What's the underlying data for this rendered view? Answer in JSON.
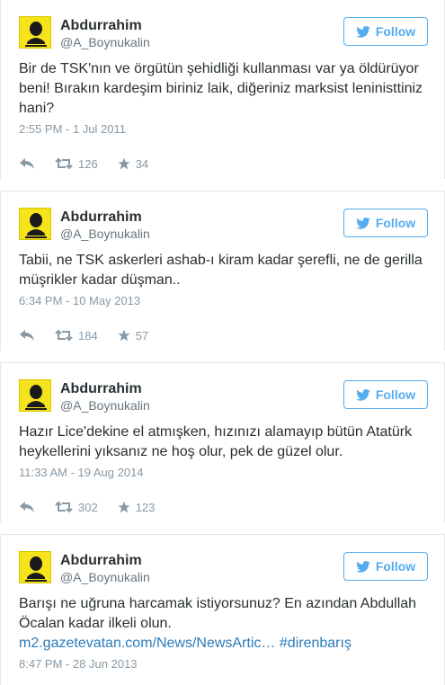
{
  "colors": {
    "accent": "#55acee",
    "link": "#2b7bb9",
    "muted": "#8899a6",
    "avatar_bg": "#f5e31c"
  },
  "tweets": [
    {
      "name": "Abdurrahim",
      "handle": "@A_Boynukalin",
      "follow_label": "Follow",
      "text": "Bir de TSK'nın ve örgütün şehidliği kullanması var ya öldürüyor beni! Bırakın kardeşim biriniz laik, diğeriniz marksist leninisttiniz hani?",
      "time": "2:55 PM - 1 Jul 2011",
      "retweets": "126",
      "favorites": "34"
    },
    {
      "name": "Abdurrahim",
      "handle": "@A_Boynukalin",
      "follow_label": "Follow",
      "text": "Tabii, ne TSK askerleri ashab-ı kiram kadar şerefli, ne de gerilla müşrikler kadar düşman..",
      "time": "6:34 PM - 10 May 2013",
      "retweets": "184",
      "favorites": "57"
    },
    {
      "name": "Abdurrahim",
      "handle": "@A_Boynukalin",
      "follow_label": "Follow",
      "text": "Hazır Lice'dekine el atmışken, hızınızı alamayıp bütün Atatürk heykellerini yıksanız ne hoş olur, pek de güzel olur.",
      "time": "11:33 AM - 19 Aug 2014",
      "retweets": "302",
      "favorites": "123"
    },
    {
      "name": "Abdurrahim",
      "handle": "@A_Boynukalin",
      "follow_label": "Follow",
      "text": "Barışı ne uğruna harcamak istiyorsunuz? En azından Abdullah Öcalan kadar ilkeli olun.",
      "link": "m2.gazetevatan.com/News/NewsArtic…",
      "hashtag": "#direnbarış",
      "time": "8:47 PM - 28 Jun 2013"
    }
  ]
}
